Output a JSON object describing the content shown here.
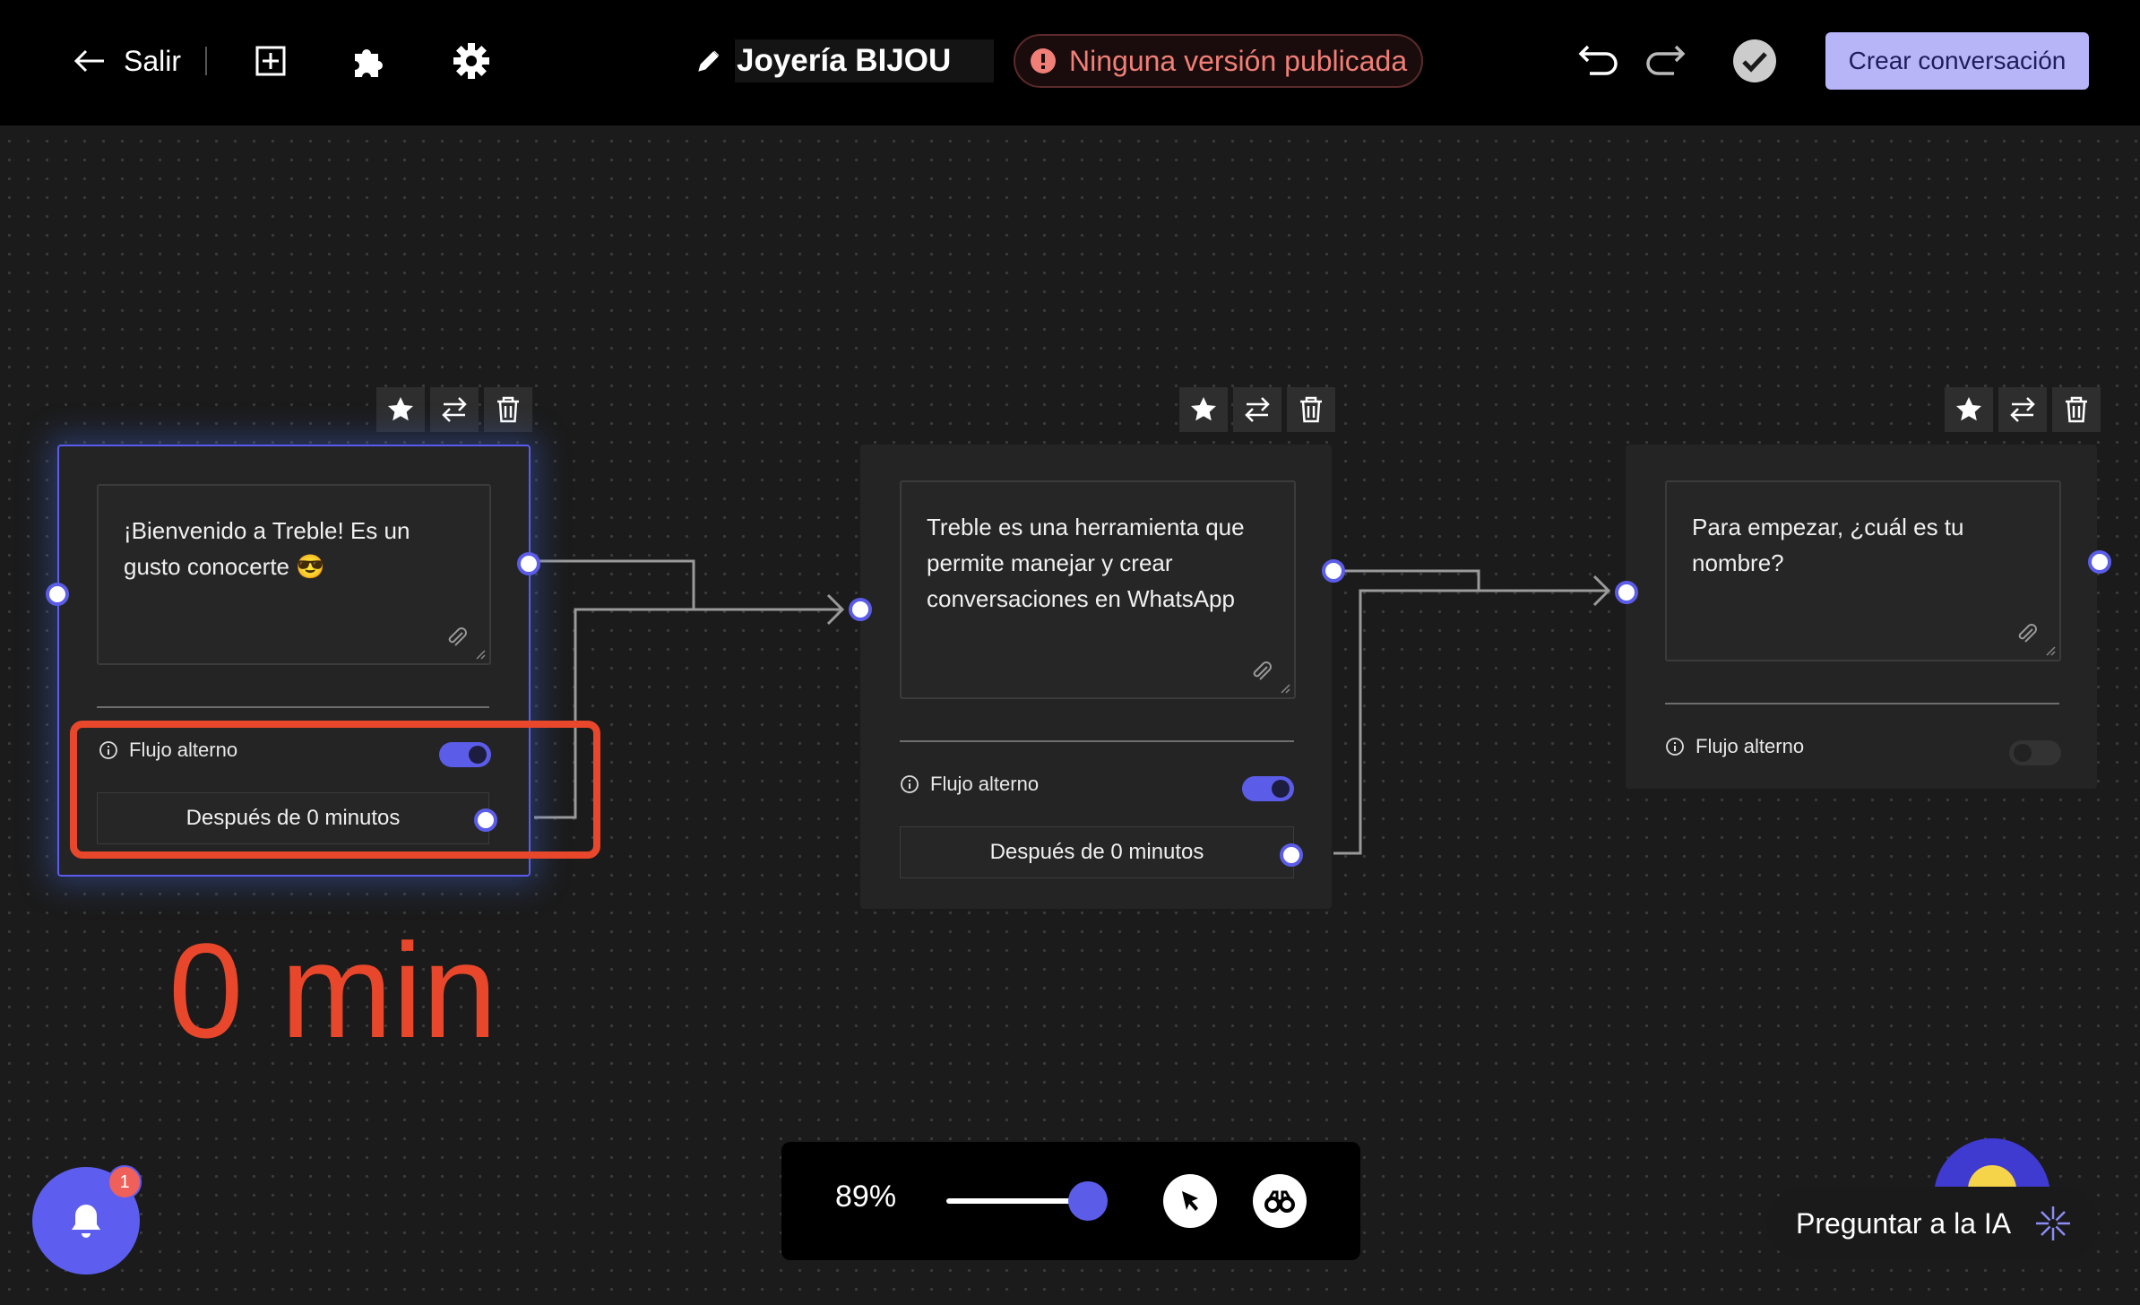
{
  "header": {
    "exit_label": "Salir",
    "title": "Joyería BIJOU",
    "status": "Ninguna versión publicada",
    "primary_button": "Crear conversación",
    "icons": [
      "arrow-left-icon",
      "add-square-icon",
      "puzzle-icon",
      "gear-icon",
      "pencil-icon",
      "alert-icon",
      "undo-icon",
      "redo-icon",
      "check-circle-icon"
    ]
  },
  "nodes": [
    {
      "message": "¡Bienvenido a Treble! Es un gusto conocerte 😎",
      "alt_flow_label": "Flujo alterno",
      "alt_flow_enabled": true,
      "after_label": "Después de 0 minutos"
    },
    {
      "message": "Treble es una herramienta que permite manejar y crear conversaciones en WhatsApp",
      "alt_flow_label": "Flujo alterno",
      "alt_flow_enabled": true,
      "after_label": "Después de 0 minutos"
    },
    {
      "message": "Para empezar, ¿cuál es tu nombre?",
      "alt_flow_label": "Flujo alterno",
      "alt_flow_enabled": false
    }
  ],
  "annotation": {
    "text": "0 min",
    "color": "#e9472b"
  },
  "zoom": {
    "label": "89%",
    "value": 0.89
  },
  "notifications": {
    "count": "1"
  },
  "ai": {
    "label": "Preguntar a la IA"
  },
  "colors": {
    "accent": "#5b5ce8",
    "button": "#b7b4f8",
    "status": "#f07f77",
    "annotation": "#e9472b"
  }
}
